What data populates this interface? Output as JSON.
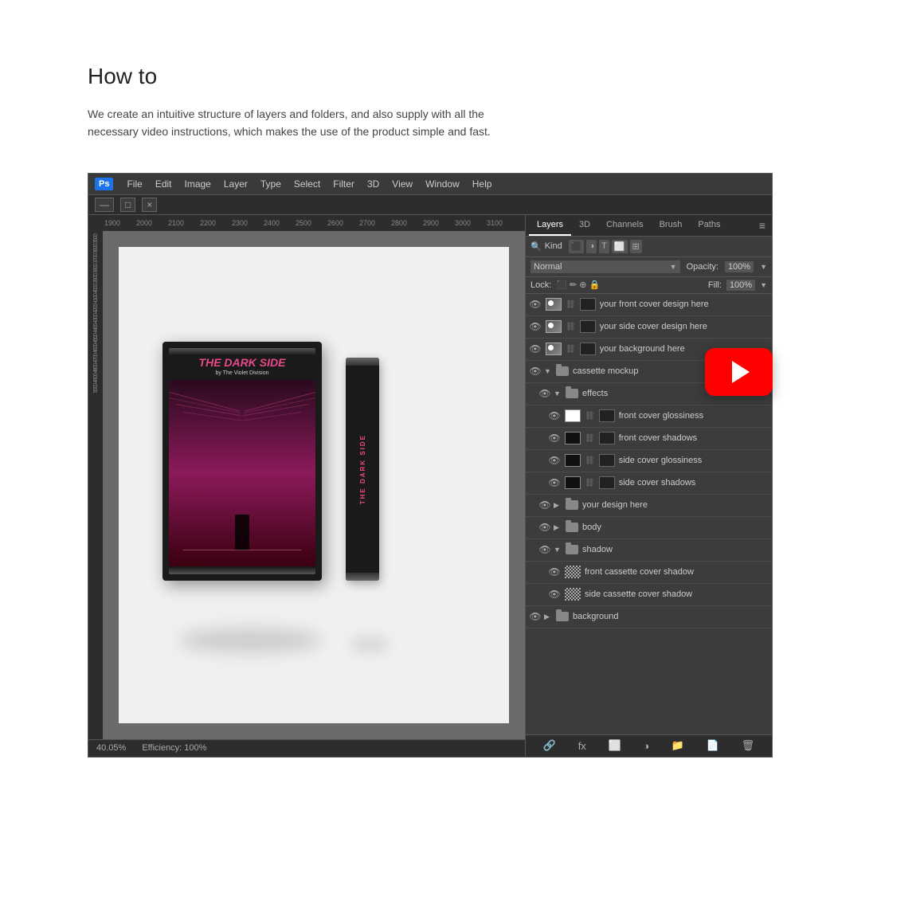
{
  "page": {
    "title": "How to",
    "description": "We create an intuitive structure of layers and folders, and also supply with all the necessary video instructions, which makes the use of the product simple and fast."
  },
  "photoshop": {
    "logo": "Ps",
    "menu_items": [
      "File",
      "Edit",
      "Image",
      "Layer",
      "Type",
      "Select",
      "Filter",
      "3D",
      "View",
      "Window",
      "Help"
    ],
    "title_icons": [
      "—",
      "□",
      "×"
    ],
    "ruler_numbers": [
      "1900",
      "2000",
      "2100",
      "2200",
      "2300",
      "2400",
      "2500",
      "2600",
      "2700",
      "2800",
      "2900",
      "3000",
      "3100"
    ],
    "status": {
      "zoom": "40.05%",
      "efficiency": "Efficiency: 100%"
    }
  },
  "layers_panel": {
    "tabs": [
      "Layers",
      "3D",
      "Channels",
      "Brush",
      "Paths"
    ],
    "active_tab": "Layers",
    "kind_label": "Kind",
    "blend_mode": "Normal",
    "opacity_label": "Opacity:",
    "opacity_value": "100%",
    "lock_label": "Lock:",
    "fill_label": "Fill:",
    "fill_value": "100%",
    "layers": [
      {
        "id": 1,
        "name": "your front cover design here",
        "type": "layer",
        "visible": true,
        "indent": 0
      },
      {
        "id": 2,
        "name": "your side cover design here",
        "type": "layer",
        "visible": true,
        "indent": 0
      },
      {
        "id": 3,
        "name": "your background here",
        "type": "layer",
        "visible": true,
        "indent": 0
      },
      {
        "id": 4,
        "name": "cassette mockup",
        "type": "folder",
        "visible": true,
        "indent": 0,
        "expanded": true
      },
      {
        "id": 5,
        "name": "effects",
        "type": "folder",
        "visible": true,
        "indent": 1,
        "expanded": true
      },
      {
        "id": 6,
        "name": "front cover glossiness",
        "type": "layer",
        "visible": true,
        "indent": 2
      },
      {
        "id": 7,
        "name": "front cover shadows",
        "type": "layer",
        "visible": true,
        "indent": 2
      },
      {
        "id": 8,
        "name": "side cover glossiness",
        "type": "layer",
        "visible": true,
        "indent": 2
      },
      {
        "id": 9,
        "name": "side cover shadows",
        "type": "layer",
        "visible": true,
        "indent": 2
      },
      {
        "id": 10,
        "name": "your design here",
        "type": "folder",
        "visible": true,
        "indent": 1,
        "expanded": false
      },
      {
        "id": 11,
        "name": "body",
        "type": "folder",
        "visible": true,
        "indent": 1,
        "expanded": false
      },
      {
        "id": 12,
        "name": "shadow",
        "type": "folder",
        "visible": true,
        "indent": 1,
        "expanded": true
      },
      {
        "id": 13,
        "name": "front cassette cover shadow",
        "type": "layer-checkered",
        "visible": true,
        "indent": 2
      },
      {
        "id": 14,
        "name": "side cassette cover shadow",
        "type": "layer-checkered",
        "visible": true,
        "indent": 2
      },
      {
        "id": 15,
        "name": "background",
        "type": "folder",
        "visible": true,
        "indent": 0,
        "expanded": false
      }
    ]
  },
  "cassette": {
    "title": "THE DARK SIDE",
    "subtitle": "by The Violet Division",
    "side_text": "THE DARK SIDE"
  }
}
